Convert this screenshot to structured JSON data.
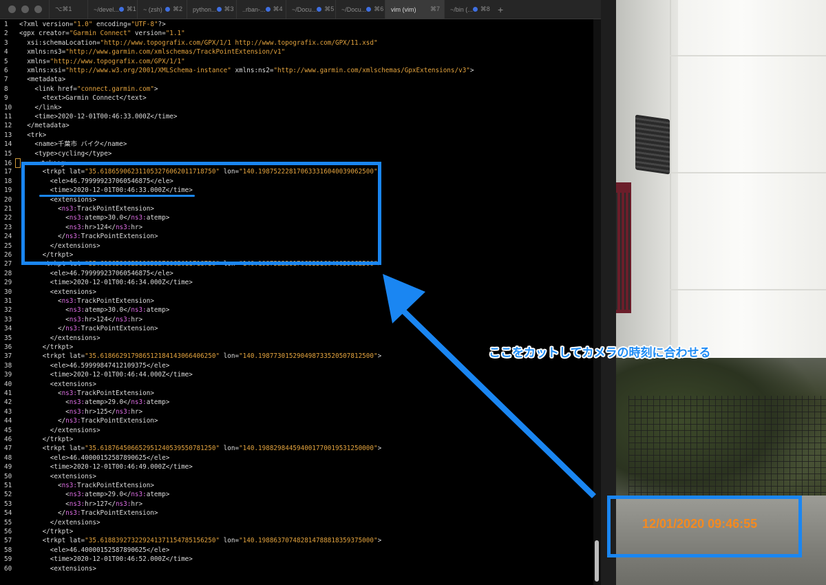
{
  "terminal": {
    "first_tab_label": "⌥⌘1",
    "tabs": [
      {
        "title": "~/devel...",
        "shortcut": "⌘1",
        "active": false
      },
      {
        "title": "~ (zsh)",
        "shortcut": "⌘2",
        "active": false
      },
      {
        "title": "python...",
        "shortcut": "⌘3",
        "active": false
      },
      {
        "title": "..rban-...",
        "shortcut": "⌘4",
        "active": false
      },
      {
        "title": "~/Docu...",
        "shortcut": "⌘5",
        "active": false
      },
      {
        "title": "~/Docu...",
        "shortcut": "⌘6",
        "active": false
      },
      {
        "title": "vim (vim)",
        "shortcut": "⌘7",
        "active": true
      },
      {
        "title": "~/bin (...",
        "shortcut": "⌘8",
        "active": false
      }
    ],
    "add_tab_label": "+"
  },
  "editor": {
    "lines": [
      {
        "n": "1",
        "text": "<?xml version=\"1.0\" encoding=\"UTF-8\"?>"
      },
      {
        "n": "2",
        "text": "<gpx creator=\"Garmin Connect\" version=\"1.1\""
      },
      {
        "n": "3",
        "text": "  xsi:schemaLocation=\"http://www.topografix.com/GPX/1/1 http://www.topografix.com/GPX/11.xsd\""
      },
      {
        "n": "4",
        "text": "  xmlns:ns3=\"http://www.garmin.com/xmlschemas/TrackPointExtension/v1\""
      },
      {
        "n": "5",
        "text": "  xmlns=\"http://www.topografix.com/GPX/1/1\""
      },
      {
        "n": "6",
        "text": "  xmlns:xsi=\"http://www.w3.org/2001/XMLSchema-instance\" xmlns:ns2=\"http://www.garmin.com/xmlschemas/GpxExtensions/v3\">"
      },
      {
        "n": "7",
        "text": "  <metadata>"
      },
      {
        "n": "8",
        "text": "    <link href=\"connect.garmin.com\">"
      },
      {
        "n": "9",
        "text": "      <text>Garmin Connect</text>"
      },
      {
        "n": "10",
        "text": "    </link>"
      },
      {
        "n": "11",
        "text": "    <time>2020-12-01T00:46:33.000Z</time>"
      },
      {
        "n": "12",
        "text": "  </metadata>"
      },
      {
        "n": "13",
        "text": "  <trk>"
      },
      {
        "n": "14",
        "text": "    <name>千葉市 バイク</name>"
      },
      {
        "n": "15",
        "text": "    <type>cycling</type>"
      },
      {
        "n": "16",
        "text": "    <trkseg>"
      },
      {
        "n": "17",
        "text": "      <trkpt lat=\"35.618659062311053276062011718750\" lon=\"140.198752228170633316040039062500\">"
      },
      {
        "n": "18",
        "text": "        <ele>46.799999237060546875</ele>"
      },
      {
        "n": "19",
        "text": "        <time>2020-12-01T00:46:33.000Z</time>"
      },
      {
        "n": "20",
        "text": "        <extensions>"
      },
      {
        "n": "21",
        "text": "          <ns3:TrackPointExtension>"
      },
      {
        "n": "22",
        "text": "            <ns3:atemp>30.0</ns3:atemp>"
      },
      {
        "n": "23",
        "text": "            <ns3:hr>124</ns3:hr>"
      },
      {
        "n": "24",
        "text": "          </ns3:TrackPointExtension>"
      },
      {
        "n": "25",
        "text": "        </extensions>"
      },
      {
        "n": "26",
        "text": "      </trkpt>"
      },
      {
        "n": "27",
        "text": "      <trkpt lat=\"35.618659062311053276062011718750\" lon=\"140.198752228170633316040039062500\">"
      },
      {
        "n": "28",
        "text": "        <ele>46.799999237060546875</ele>"
      },
      {
        "n": "29",
        "text": "        <time>2020-12-01T00:46:34.000Z</time>"
      },
      {
        "n": "30",
        "text": "        <extensions>"
      },
      {
        "n": "31",
        "text": "          <ns3:TrackPointExtension>"
      },
      {
        "n": "32",
        "text": "            <ns3:atemp>30.0</ns3:atemp>"
      },
      {
        "n": "33",
        "text": "            <ns3:hr>124</ns3:hr>"
      },
      {
        "n": "34",
        "text": "          </ns3:TrackPointExtension>"
      },
      {
        "n": "35",
        "text": "        </extensions>"
      },
      {
        "n": "36",
        "text": "      </trkpt>"
      },
      {
        "n": "37",
        "text": "      <trkpt lat=\"35.618662917986512184143066406250\" lon=\"140.198773015290498733520507812500\">"
      },
      {
        "n": "38",
        "text": "        <ele>46.59999847412109375</ele>"
      },
      {
        "n": "39",
        "text": "        <time>2020-12-01T00:46:44.000Z</time>"
      },
      {
        "n": "40",
        "text": "        <extensions>"
      },
      {
        "n": "41",
        "text": "          <ns3:TrackPointExtension>"
      },
      {
        "n": "42",
        "text": "            <ns3:atemp>29.0</ns3:atemp>"
      },
      {
        "n": "43",
        "text": "            <ns3:hr>125</ns3:hr>"
      },
      {
        "n": "44",
        "text": "          </ns3:TrackPointExtension>"
      },
      {
        "n": "45",
        "text": "        </extensions>"
      },
      {
        "n": "46",
        "text": "      </trkpt>"
      },
      {
        "n": "47",
        "text": "      <trkpt lat=\"35.618764506652951240539550781250\" lon=\"140.198829844594001770019531250000\">"
      },
      {
        "n": "48",
        "text": "        <ele>46.40000152587890625</ele>"
      },
      {
        "n": "49",
        "text": "        <time>2020-12-01T00:46:49.000Z</time>"
      },
      {
        "n": "50",
        "text": "        <extensions>"
      },
      {
        "n": "51",
        "text": "          <ns3:TrackPointExtension>"
      },
      {
        "n": "52",
        "text": "            <ns3:atemp>29.0</ns3:atemp>"
      },
      {
        "n": "53",
        "text": "            <ns3:hr>127</ns3:hr>"
      },
      {
        "n": "54",
        "text": "          </ns3:TrackPointExtension>"
      },
      {
        "n": "55",
        "text": "        </extensions>"
      },
      {
        "n": "56",
        "text": "      </trkpt>"
      },
      {
        "n": "57",
        "text": "      <trkpt lat=\"35.618839273229241371154785156250\" lon=\"140.198863707482814788818359375000\">"
      },
      {
        "n": "58",
        "text": "        <ele>46.40000152587890625</ele>"
      },
      {
        "n": "59",
        "text": "        <time>2020-12-01T00:46:52.000Z</time>"
      },
      {
        "n": "60",
        "text": "        <extensions>"
      }
    ]
  },
  "annotation": {
    "text": "ここをカットしてカメラの時刻に合わせる",
    "color": "#1a86f2"
  },
  "photo": {
    "camera_timestamp": "12/01/2020 09:46:55",
    "timestamp_color": "#f58a1f"
  }
}
